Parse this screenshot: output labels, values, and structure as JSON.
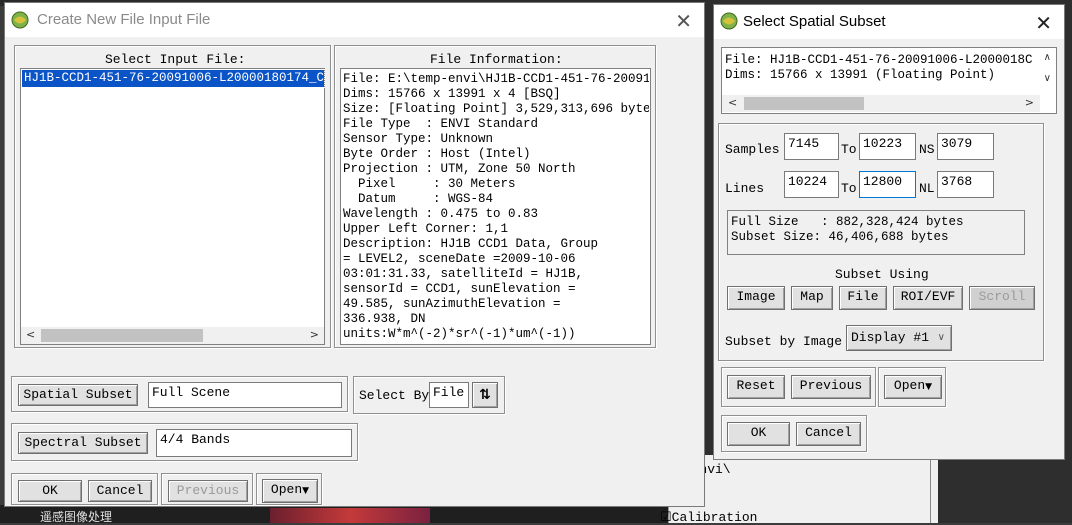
{
  "background": {
    "bottom_left_text": "遥感图像处理",
    "panel_text": "p-envi\\",
    "panel_text2": "☑Calibration"
  },
  "left_window": {
    "title": "Create New File Input File",
    "select_input_label": "Select Input File:",
    "input_files": [
      "HJ1B-CCD1-451-76-20091006-L20000180174_C"
    ],
    "file_info_label": "File Information:",
    "file_info_lines": [
      "File: E:\\temp-envi\\HJ1B-CCD1-451-76-20091",
      "Dims: 15766 x 13991 x 4 [BSQ]",
      "Size: [Floating Point] 3,529,313,696 byte",
      "File Type  : ENVI Standard",
      "Sensor Type: Unknown",
      "Byte Order : Host (Intel)",
      "Projection : UTM, Zone 50 North",
      "  Pixel     : 30 Meters",
      "  Datum     : WGS-84",
      "Wavelength : 0.475 to 0.83",
      "Upper Left Corner: 1,1",
      "Description: HJ1B CCD1 Data, Group",
      "= LEVEL2, sceneDate =2009-10-06",
      "03:01:31.33, satelliteId = HJ1B,",
      "sensorId = CCD1, sunElevation =",
      "49.585, sunAzimuthElevation =",
      "336.938, DN",
      "units:W*m^(-2)*sr^(-1)*um^(-1))"
    ],
    "spatial_subset_button": "Spatial Subset",
    "spatial_subset_value": "Full Scene",
    "select_by_label": "Select By",
    "select_by_value": "File",
    "spectral_subset_button": "Spectral Subset",
    "spectral_subset_value": "4/4 Bands",
    "ok": "OK",
    "cancel": "Cancel",
    "previous": "Previous",
    "open": "Open"
  },
  "right_window": {
    "title": "Select Spatial Subset",
    "file_line": "File: HJ1B-CCD1-451-76-20091006-L2000018C",
    "dims_line": "Dims: 15766 x 13991 (Floating Point)",
    "samples_label": "Samples",
    "samples_from": "7145",
    "to_label": "To",
    "samples_to": "10223",
    "ns_label": "NS",
    "ns_value": "3079",
    "lines_label": "Lines",
    "lines_from": "10224",
    "lines_to": "12800",
    "nl_label": "NL",
    "nl_value": "3768",
    "full_size": "Full Size   : 882,328,424 bytes",
    "subset_size": "Subset Size: 46,406,688 bytes",
    "subset_using_label": "Subset Using",
    "btn_image": "Image",
    "btn_map": "Map",
    "btn_file": "File",
    "btn_roi": "ROI/EVF",
    "btn_scroll": "Scroll",
    "subset_by_image_label": "Subset by Image",
    "display_value": "Display #1",
    "reset": "Reset",
    "previous": "Previous",
    "open": "Open",
    "ok": "OK",
    "cancel": "Cancel"
  }
}
